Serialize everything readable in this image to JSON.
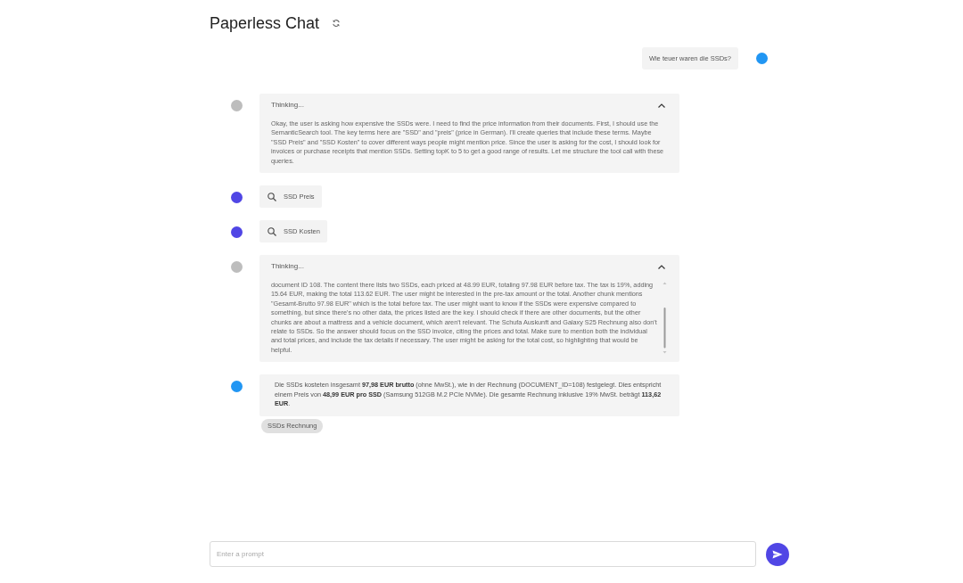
{
  "header": {
    "title": "Paperless Chat"
  },
  "messages": [
    {
      "kind": "user",
      "color": "#2196f3",
      "text": "Wie teuer waren die SSDs?"
    },
    {
      "kind": "thinking",
      "color": "#bdbdbd",
      "label": "Thinking...",
      "expanded": true,
      "text": "Okay, the user is asking how expensive the SSDs were. I need to find the price information from their documents. First, I should use the SemanticSearch tool. The key terms here are \"SSD\" and \"preis\" (price in German). I'll create queries that include these terms. Maybe \"SSD Preis\" and \"SSD Kosten\" to cover different ways people might mention price. Since the user is asking for the cost, I should look for invoices or purchase receipts that mention SSDs. Setting topK to 5 to get a good range of results. Let me structure the tool call with these queries."
    },
    {
      "kind": "tool",
      "color": "#5046e5",
      "query": "SSD Preis"
    },
    {
      "kind": "tool",
      "color": "#5046e5",
      "query": "SSD Kosten"
    },
    {
      "kind": "thinking",
      "color": "#bdbdbd",
      "label": "Thinking...",
      "expanded": true,
      "text": "document ID 108. The content there lists two SSDs, each priced at 48.99 EUR, totaling 97.98 EUR before tax. The tax is 19%, adding 15.64 EUR, making the total 113.62 EUR. The user might be interested in the pre-tax amount or the total. Another chunk mentions \"Gesamt-Brutto 97.98 EUR\" which is the total before tax. The user might want to know if the SSDs were expensive compared to something, but since there's no other data, the prices listed are the key. I should check if there are other documents, but the other chunks are about a mattress and a vehicle document, which aren't relevant. The Schufa Auskunft and Galaxy S25 Rechnung also don't relate to SSDs. So the answer should focus on the SSD invoice, citing the prices and total. Make sure to mention both the individual and total prices, and include the tax details if necessary. The user might be asking for the total cost, so highlighting that would be helpful."
    },
    {
      "kind": "answer",
      "color": "#2196f3",
      "text": "Die SSDs kosteten insgesamt **97,98 EUR brutto** (ohne MwSt.), wie in der Rechnung (DOCUMENT_ID=108) festgelegt. Dies entspricht einem Preis von **48,99 EUR pro SSD** (Samsung 512GB M.2 PCIe NVMe). Die gesamte Rechnung inklusive 19% MwSt. beträgt **113,62 EUR**.",
      "sources": [
        "SSDs Rechnung"
      ]
    }
  ],
  "prompt": {
    "placeholder": "Enter a prompt"
  }
}
